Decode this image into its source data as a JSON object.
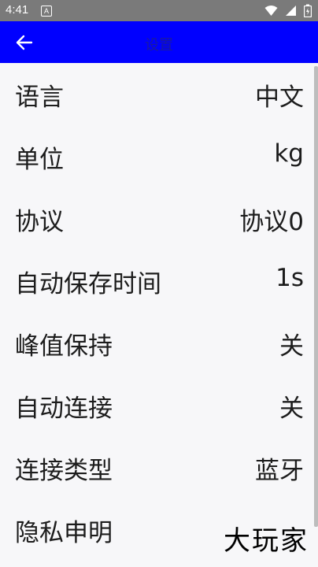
{
  "status_bar": {
    "time": "4:41",
    "notification_glyph": "A",
    "icons": [
      "wifi-icon",
      "signal-icon",
      "battery-icon"
    ]
  },
  "app_bar": {
    "title": "设置",
    "back_icon": "arrow-left-icon"
  },
  "settings": [
    {
      "label": "语言",
      "value": "中文"
    },
    {
      "label": "单位",
      "value": "kg"
    },
    {
      "label": "协议",
      "value": "协议0"
    },
    {
      "label": "自动保存时间",
      "value": "1s"
    },
    {
      "label": "峰值保持",
      "value": "关"
    },
    {
      "label": "自动连接",
      "value": "关"
    },
    {
      "label": "连接类型",
      "value": "蓝牙"
    },
    {
      "label": "隐私申明",
      "value": ""
    }
  ],
  "watermark": "大玩家",
  "colors": {
    "app_bar": "#0000ff",
    "status_bar": "#7a7a7a",
    "background": "#f7f7f9",
    "text": "#1c1c1c"
  }
}
